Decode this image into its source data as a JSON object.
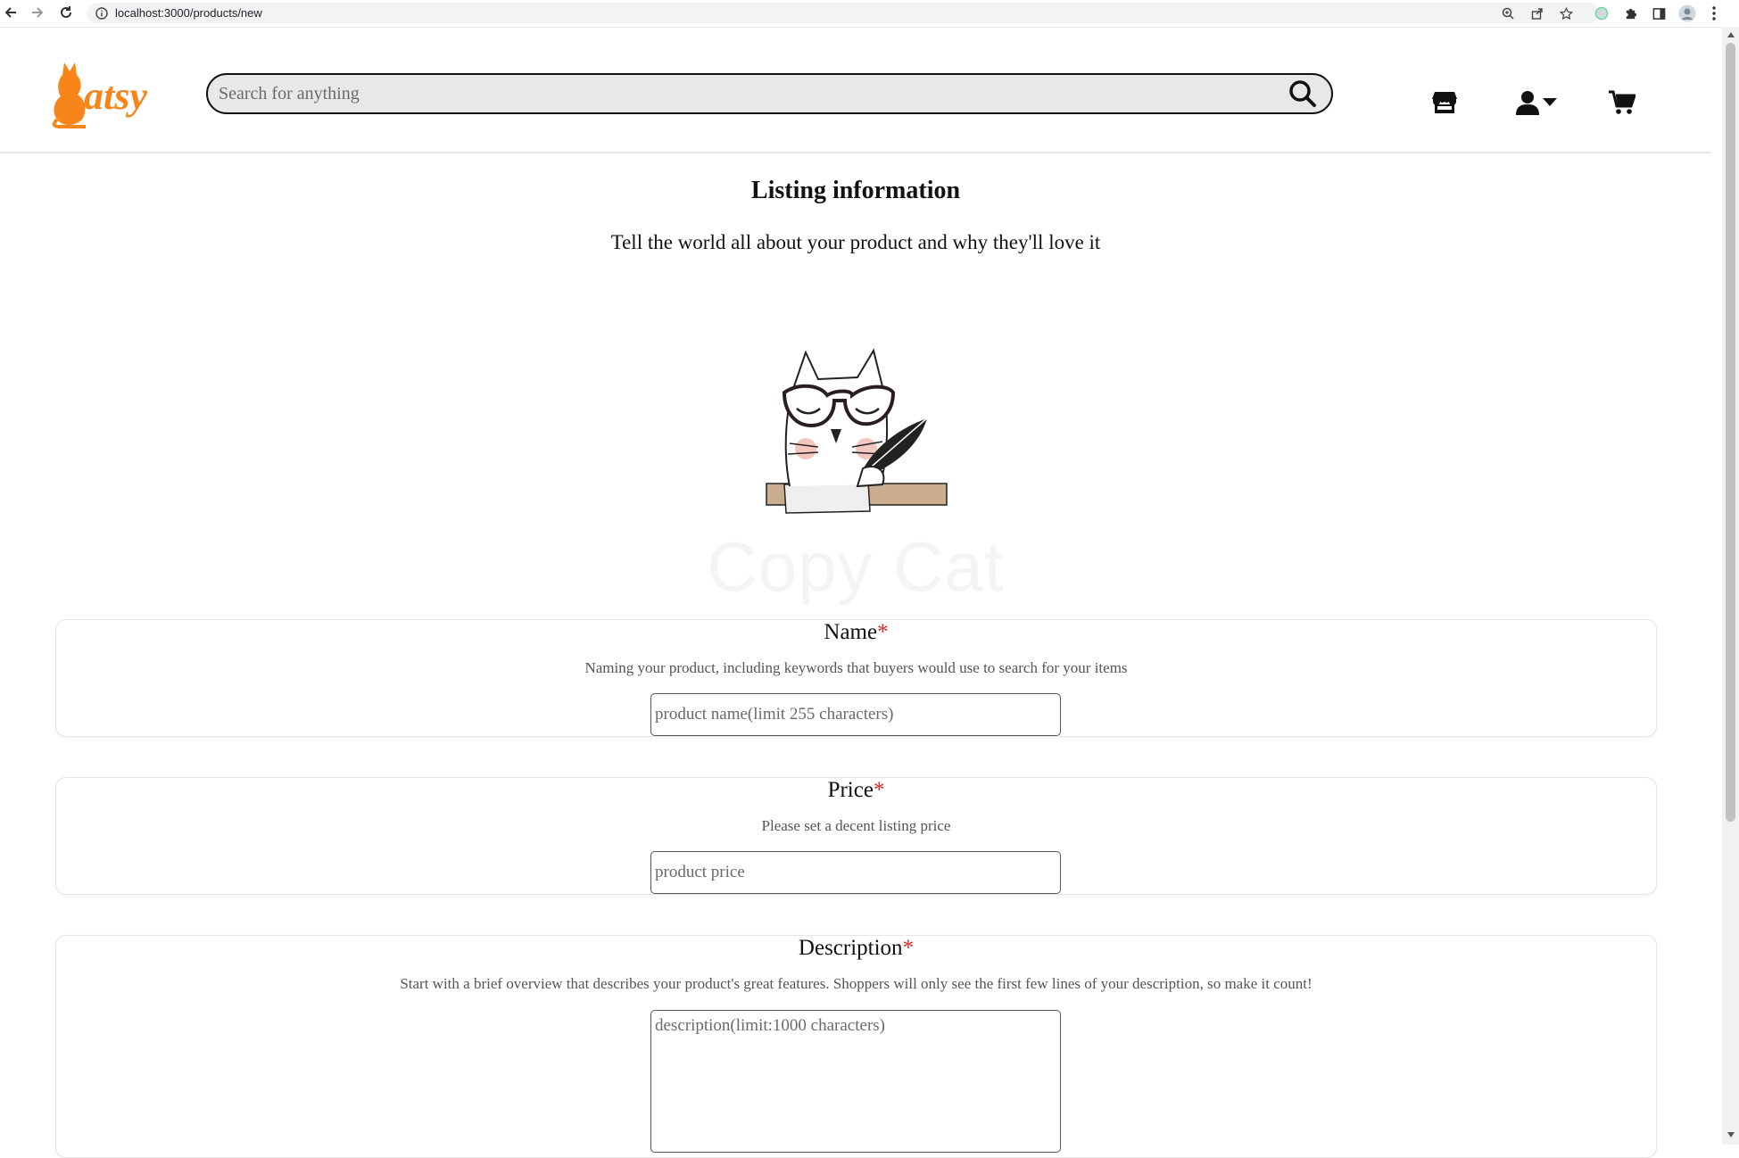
{
  "browser": {
    "url": "localhost:3000/products/new",
    "icons": [
      "back-icon",
      "forward-icon",
      "reload-icon",
      "info-icon",
      "zoom-icon",
      "share-icon",
      "bookmark-star-icon",
      "extension-icon",
      "puzzle-icon",
      "sidepanel-icon",
      "profile-avatar",
      "menu-kebab-icon"
    ]
  },
  "header": {
    "logo_text": "atsy",
    "search_placeholder": "Search for anything",
    "icons": [
      "store-icon",
      "user-icon",
      "caret-down-icon",
      "cart-icon"
    ]
  },
  "main": {
    "title": "Listing information",
    "subtitle": "Tell the world all about your product and why they'll love it",
    "brand_caption": "Copy Cat",
    "required_mark": "*",
    "fields": {
      "name": {
        "label": "Name",
        "help": "Naming your product, including keywords that buyers would use to search for your items",
        "placeholder": "product name(limit 255 characters)"
      },
      "price": {
        "label": "Price",
        "help": "Please set a decent listing price",
        "placeholder": "product price"
      },
      "description": {
        "label": "Description",
        "help": "Start with a brief overview that describes your product's great features. Shoppers will only see the first few lines of your description, so make it count!",
        "placeholder": "description(limit:1000 characters)"
      }
    }
  },
  "colors": {
    "brand_orange": "#f7851a",
    "required_red": "#e02424",
    "search_bg": "#e8e8e8"
  }
}
